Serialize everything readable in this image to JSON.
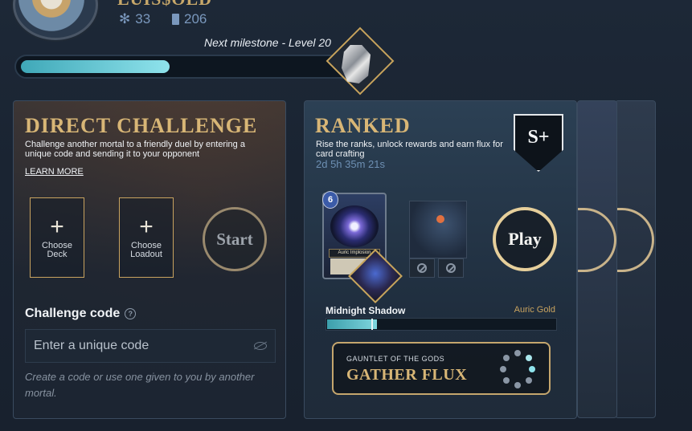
{
  "profile": {
    "name": "LUIS$OLD",
    "stats": [
      {
        "icon": "snowflake-icon",
        "value": "33"
      },
      {
        "icon": "cards-icon",
        "value": "206"
      }
    ],
    "milestone": "Next milestone - Level 20",
    "progress_fraction": 0.45
  },
  "direct_challenge": {
    "title": "DIRECT CHALLENGE",
    "description": "Challenge another mortal to a friendly duel by entering a unique code and sending it to your opponent",
    "learn_more": "LEARN MORE",
    "choose_deck": "Choose Deck",
    "choose_loadout": "Choose Loadout",
    "start": "Start",
    "code_label": "Challenge code",
    "code_help": "?",
    "code_placeholder": "Enter a unique code",
    "hint": "Create a code or use one given to you by another mortal."
  },
  "ranked": {
    "title": "RANKED",
    "description": "Rise the ranks, unlock rewards and earn flux for card crafting",
    "timer": "2d 5h 35m 21s",
    "rank_badge": "S+",
    "card": {
      "cost": "6",
      "name": "Auric Implosion"
    },
    "play": "Play",
    "current_rank": "Midnight Shadow",
    "next_rank": "Auric Gold",
    "rank_progress_fraction": 0.22,
    "gauntlet_subtitle": "GAUNTLET OF THE GODS",
    "gauntlet_title": "GATHER FLUX"
  },
  "colors": {
    "accent_gold": "#d8b676",
    "progress_teal": "#8fe3ec"
  }
}
